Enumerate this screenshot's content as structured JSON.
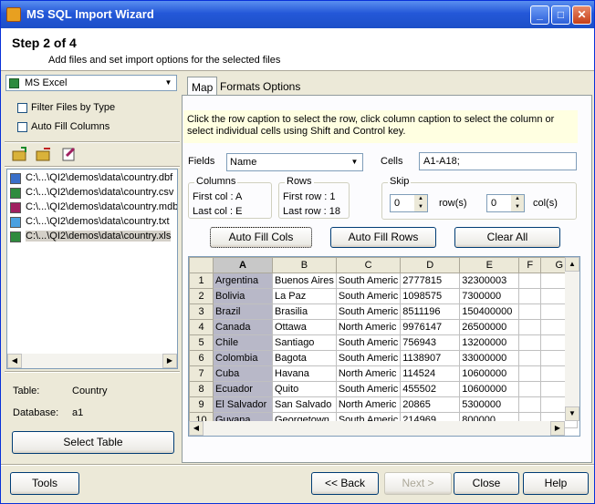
{
  "window": {
    "title": "MS SQL Import Wizard",
    "btn_min": "_",
    "btn_max": "□",
    "btn_close": "✕"
  },
  "header": {
    "step": "Step 2 of 4",
    "description": "Add files and set import options for the selected files"
  },
  "left": {
    "format_select": "MS Excel",
    "filter_label": "Filter Files by Type",
    "autofill_label": "Auto Fill Columns",
    "files": [
      {
        "path": "C:\\...\\QI2\\demos\\data\\country.dbf",
        "icon": "dbf-file-icon"
      },
      {
        "path": "C:\\...\\QI2\\demos\\data\\country.csv",
        "icon": "csv-file-icon"
      },
      {
        "path": "C:\\...\\QI2\\demos\\data\\country.mdb",
        "icon": "mdb-file-icon"
      },
      {
        "path": "C:\\...\\QI2\\demos\\data\\country.txt",
        "icon": "txt-file-icon"
      },
      {
        "path": "C:\\...\\QI2\\demos\\data\\country.xls",
        "icon": "xls-file-icon"
      }
    ],
    "table_label": "Table:",
    "table_value": "Country",
    "database_label": "Database:",
    "database_value": "a1",
    "select_table": "Select Table"
  },
  "tabs": [
    "Map",
    "Formats",
    "Options"
  ],
  "map": {
    "info": "Click the row caption to select the row, click column caption to select the column or select individual cells using Shift and Control key.",
    "fields_label": "Fields",
    "fields_value": "Name",
    "cells_label": "Cells",
    "cells_value": "A1-A18;",
    "columns_title": "Columns",
    "first_col": "First col  : A",
    "last_col": "Last col   : E",
    "rows_title": "Rows",
    "first_row": "First row  : 1",
    "last_row": "Last row   : 18",
    "skip_title": "Skip",
    "skip_rows": "0",
    "rows_unit": "row(s)",
    "skip_cols": "0",
    "cols_unit": "col(s)",
    "auto_fill_cols": "Auto Fill Cols",
    "auto_fill_rows": "Auto Fill Rows",
    "clear_all": "Clear All"
  },
  "grid": {
    "columns": [
      "A",
      "B",
      "C",
      "D",
      "E",
      "F",
      "G"
    ],
    "rows": [
      [
        "1",
        "Argentina",
        "Buenos Aires",
        "South Americ",
        "2777815",
        "32300003"
      ],
      [
        "2",
        "Bolivia",
        "La Paz",
        "South Americ",
        "1098575",
        "7300000"
      ],
      [
        "3",
        "Brazil",
        "Brasilia",
        "South Americ",
        "8511196",
        "150400000"
      ],
      [
        "4",
        "Canada",
        "Ottawa",
        "North Americ",
        "9976147",
        "26500000"
      ],
      [
        "5",
        "Chile",
        "Santiago",
        "South Americ",
        "756943",
        "13200000"
      ],
      [
        "6",
        "Colombia",
        "Bagota",
        "South Americ",
        "1138907",
        "33000000"
      ],
      [
        "7",
        "Cuba",
        "Havana",
        "North Americ",
        "114524",
        "10600000"
      ],
      [
        "8",
        "Ecuador",
        "Quito",
        "South Americ",
        "455502",
        "10600000"
      ],
      [
        "9",
        "El Salvador",
        "San Salvado",
        "North Americ",
        "20865",
        "5300000"
      ],
      [
        "10",
        "Guyana",
        "Georgetown",
        "South Americ",
        "214969",
        "800000"
      ]
    ]
  },
  "footer": {
    "tools": "Tools",
    "back": "<< Back",
    "next": "Next >",
    "close": "Close",
    "help": "Help"
  }
}
